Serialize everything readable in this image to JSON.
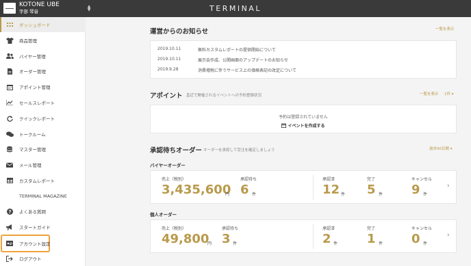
{
  "header": {
    "company": "KOTONE UBE",
    "user": "宇部 琴音",
    "app_title": "TERMINAL",
    "switch_icon": "chevron-up-down-icon"
  },
  "sidebar": {
    "items": [
      {
        "label": "ダッシュボード",
        "icon": "grid-icon",
        "active": true
      },
      {
        "label": "商品管理",
        "icon": "shirt-icon"
      },
      {
        "label": "バイヤー管理",
        "icon": "users-icon"
      },
      {
        "label": "オーダー管理",
        "icon": "document-icon"
      },
      {
        "label": "アポイント管理",
        "icon": "calendar-icon"
      },
      {
        "label": "セールスレポート",
        "icon": "chart-line-icon"
      },
      {
        "label": "クイックレポート",
        "icon": "refresh-icon"
      },
      {
        "label": "トークルーム",
        "icon": "chat-icon"
      },
      {
        "label": "マスター管理",
        "icon": "database-icon"
      },
      {
        "label": "メール管理",
        "icon": "mail-icon"
      },
      {
        "label": "カスタムレポート",
        "icon": "table-icon"
      },
      {
        "label": "TERMINAL MAGAZINE",
        "icon": ""
      },
      {
        "label": "よくある質問",
        "icon": "question-icon"
      },
      {
        "label": "スタートガイド",
        "icon": "megaphone-icon"
      },
      {
        "label": "アカウント設定",
        "icon": "id-card-icon",
        "highlighted": true
      },
      {
        "label": "ログアウト",
        "icon": "logout-icon"
      }
    ]
  },
  "news": {
    "title": "運営からのお知らせ",
    "view_all": "一覧を表示",
    "items": [
      {
        "date": "2019.10.11",
        "text": "無料カスタムレポートの提供開始について"
      },
      {
        "date": "2019.10.11",
        "text": "展示会作成、公開画面のアップデートのお知らせ"
      },
      {
        "date": "2019.9.28",
        "text": "消費増税に伴うサービス上の価格表記の改定について"
      }
    ]
  },
  "appointments": {
    "title": "アポイント",
    "subtitle": "直近で開催されるイベントへの予約登録状況",
    "view_all": "一覧を表示",
    "count": "1件 ▾",
    "empty": "予約は登録されていません",
    "create": "イベントを作成する"
  },
  "approvals": {
    "title": "承認待ちオーダー",
    "subtitle": "オーダーを承認して受注を確定しましょう",
    "period": "過去90日間 ▾",
    "groups": [
      {
        "label": "バイヤーオーダー",
        "sales_label": "売上（税別）",
        "sales": "3,435,600",
        "sales_unit": "円",
        "pending_label": "承認待ち",
        "pending": "6",
        "pending_unit": "件",
        "approved_label": "承認済",
        "approved": "12",
        "approved_unit": "件",
        "done_label": "完了",
        "done": "5",
        "done_unit": "件",
        "cancel_label": "キャンセル",
        "cancel": "9",
        "cancel_unit": "件"
      },
      {
        "label": "個人オーダー",
        "sales_label": "売上（税別）",
        "sales": "49,800",
        "sales_unit": "円",
        "pending_label": "承認待ち",
        "pending": "3",
        "pending_unit": "件",
        "approved_label": "承認済",
        "approved": "2",
        "approved_unit": "件",
        "done_label": "完了",
        "done": "1",
        "done_unit": "件",
        "cancel_label": "キャンセル",
        "cancel": "0",
        "cancel_unit": "件"
      }
    ]
  },
  "colors": {
    "accent": "#b99a4b",
    "topbar": "#3a3a3a",
    "highlight": "#f0a13a"
  }
}
